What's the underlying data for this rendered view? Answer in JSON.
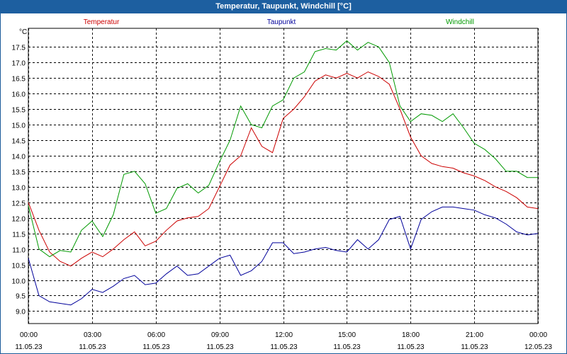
{
  "window": {
    "title": "Temperatur, Taupunkt, Windchill [°C]"
  },
  "chart_data": {
    "type": "line",
    "title": "Temperatur, Taupunkt, Windchill [°C]",
    "unit_label": "°C",
    "ylim": [
      8.6,
      18.1
    ],
    "xlim": [
      0,
      24
    ],
    "grid": true,
    "legend_position": "top",
    "y_ticks": [
      9.0,
      9.5,
      10.0,
      10.5,
      11.0,
      11.5,
      12.0,
      12.5,
      13.0,
      13.5,
      14.0,
      14.5,
      15.0,
      15.5,
      16.0,
      16.5,
      17.0,
      17.5
    ],
    "x_ticks": [
      {
        "time": "00:00",
        "date": "11.05.23",
        "hour": 0
      },
      {
        "time": "03:00",
        "date": "11.05.23",
        "hour": 3
      },
      {
        "time": "06:00",
        "date": "11.05.23",
        "hour": 6
      },
      {
        "time": "09:00",
        "date": "11.05.23",
        "hour": 9
      },
      {
        "time": "12:00",
        "date": "11.05.23",
        "hour": 12
      },
      {
        "time": "15:00",
        "date": "11.05.23",
        "hour": 15
      },
      {
        "time": "18:00",
        "date": "11.05.23",
        "hour": 18
      },
      {
        "time": "21:00",
        "date": "11.05.23",
        "hour": 21
      },
      {
        "time": "00:00",
        "date": "12.05.23",
        "hour": 24
      }
    ],
    "x": [
      0,
      0.5,
      1,
      1.5,
      2,
      2.5,
      3,
      3.5,
      4,
      4.5,
      5,
      5.5,
      6,
      6.5,
      7,
      7.5,
      8,
      8.5,
      9,
      9.5,
      10,
      10.5,
      11,
      11.5,
      12,
      12.5,
      13,
      13.5,
      14,
      14.5,
      15,
      15.5,
      16,
      16.5,
      17,
      17.5,
      18,
      18.5,
      19,
      19.5,
      20,
      20.5,
      21,
      21.5,
      22,
      22.5,
      23,
      23.5,
      24
    ],
    "series": [
      {
        "name": "Temperatur",
        "color": "#cc0000",
        "values": [
          12.5,
          11.6,
          10.9,
          10.6,
          10.45,
          10.7,
          10.9,
          10.75,
          11.0,
          11.3,
          11.55,
          11.1,
          11.25,
          11.6,
          11.9,
          12.0,
          12.05,
          12.3,
          13.0,
          13.7,
          14.0,
          14.9,
          14.3,
          14.1,
          15.2,
          15.5,
          15.9,
          16.4,
          16.6,
          16.5,
          16.65,
          16.5,
          16.7,
          16.55,
          16.3,
          15.5,
          14.6,
          14.0,
          13.75,
          13.65,
          13.6,
          13.45,
          13.35,
          13.2,
          13.0,
          12.85,
          12.65,
          12.35,
          12.3
        ]
      },
      {
        "name": "Taupunkt",
        "color": "#00009a",
        "values": [
          10.7,
          9.5,
          9.3,
          9.25,
          9.2,
          9.4,
          9.7,
          9.6,
          9.8,
          10.05,
          10.15,
          9.85,
          9.9,
          10.2,
          10.45,
          10.15,
          10.2,
          10.45,
          10.7,
          10.8,
          10.15,
          10.3,
          10.6,
          11.2,
          11.2,
          10.85,
          10.9,
          11.0,
          11.05,
          10.95,
          10.9,
          11.3,
          11.0,
          11.3,
          11.95,
          12.05,
          11.0,
          11.95,
          12.2,
          12.35,
          12.35,
          12.3,
          12.25,
          12.1,
          12.0,
          11.8,
          11.55,
          11.45,
          11.5
        ]
      },
      {
        "name": "Windchill",
        "color": "#009900",
        "values": [
          12.4,
          11.0,
          10.75,
          10.95,
          10.9,
          11.6,
          11.9,
          11.4,
          12.1,
          13.4,
          13.5,
          13.1,
          12.15,
          12.3,
          12.95,
          13.1,
          12.8,
          13.05,
          13.8,
          14.5,
          15.6,
          15.0,
          14.9,
          15.6,
          15.8,
          16.5,
          16.7,
          17.35,
          17.45,
          17.4,
          17.7,
          17.4,
          17.65,
          17.5,
          17.0,
          15.6,
          15.1,
          15.35,
          15.3,
          15.1,
          15.35,
          14.9,
          14.4,
          14.2,
          13.9,
          13.5,
          13.5,
          13.3,
          13.3
        ]
      }
    ]
  }
}
